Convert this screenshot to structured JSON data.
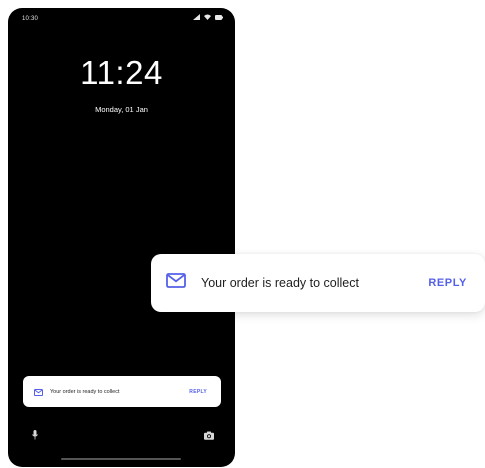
{
  "status_bar": {
    "time": "10:30",
    "icons": [
      "signal-icon",
      "wifi-icon",
      "battery-icon"
    ]
  },
  "lock_screen": {
    "clock": "11:24",
    "date": "Monday, 01 Jan"
  },
  "notification": {
    "icon": "mail-icon",
    "message": "Your order is ready to collect",
    "action_label": "REPLY"
  },
  "bottom_shortcuts": {
    "left": "mic-icon",
    "right": "camera-icon"
  },
  "colors": {
    "accent": "#5560e8",
    "screen_background": "#000000",
    "card_background": "#ffffff"
  }
}
